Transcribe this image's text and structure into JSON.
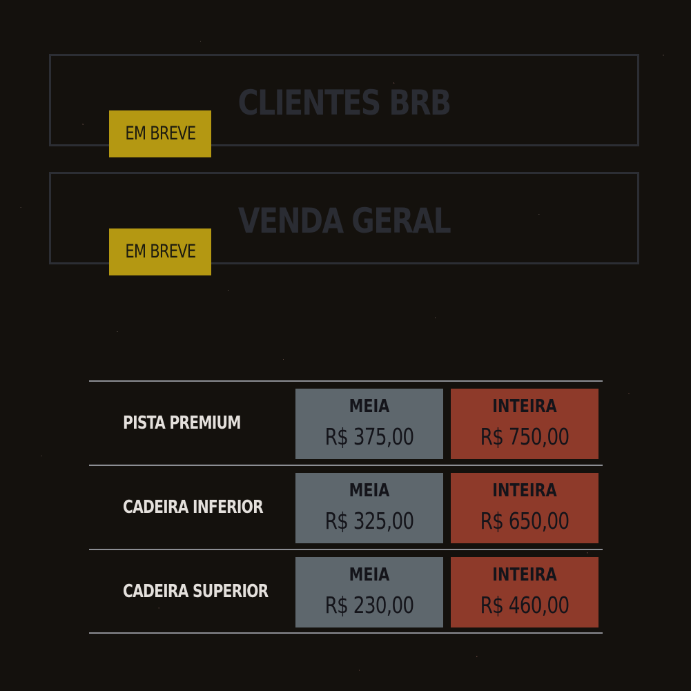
{
  "access_sections": [
    {
      "title": "CLIENTES BRB",
      "badge": "EM BREVE"
    },
    {
      "title": "VENDA GERAL",
      "badge": "EM BREVE"
    }
  ],
  "price_table": {
    "rows": [
      {
        "sector": "PISTA PREMIUM",
        "meia": {
          "label": "MEIA",
          "price": "R$ 375,00"
        },
        "inteira": {
          "label": "INTEIRA",
          "price": "R$ 750,00"
        }
      },
      {
        "sector": "CADEIRA INFERIOR",
        "meia": {
          "label": "MEIA",
          "price": "R$ 325,00"
        },
        "inteira": {
          "label": "INTEIRA",
          "price": "R$ 650,00"
        }
      },
      {
        "sector": "CADEIRA SUPERIOR",
        "meia": {
          "label": "MEIA",
          "price": "R$ 230,00"
        },
        "inteira": {
          "label": "INTEIRA",
          "price": "R$ 460,00"
        }
      }
    ]
  },
  "colors": {
    "background": "#14110d",
    "badge": "#b49812",
    "meia_box": "#5e676d",
    "inteira_box": "#8e3a2a",
    "panel_border": "#2c2e34",
    "panel_title": "#2a2c33",
    "row_divider": "#8c8e93"
  }
}
